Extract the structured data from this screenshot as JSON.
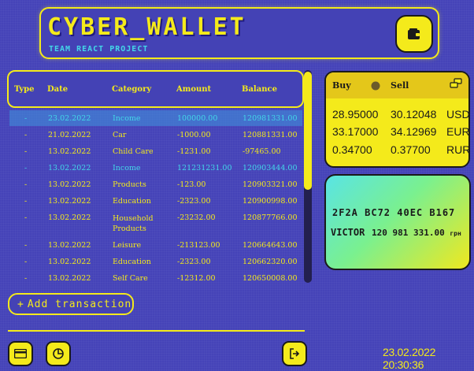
{
  "header": {
    "title": "CYBER_WALLET",
    "subtitle": "TEAM REACT PROJECT",
    "wallet_icon": "wallet-icon"
  },
  "table": {
    "headers": [
      "Type",
      "Date",
      "Category",
      "Amount",
      "Balance"
    ],
    "rows": [
      {
        "type": "-",
        "date": "23.02.2022",
        "category": "Income",
        "amount": "100000.00",
        "balance": "120981331.00",
        "kind": "income",
        "highlight": true
      },
      {
        "type": "-",
        "date": "21.02.2022",
        "category": "Car",
        "amount": "-1000.00",
        "balance": "120881331.00",
        "kind": "expense",
        "highlight": false
      },
      {
        "type": "-",
        "date": "13.02.2022",
        "category": "Child Care",
        "amount": "-1231.00",
        "balance": "-97465.00",
        "kind": "expense",
        "highlight": false
      },
      {
        "type": "-",
        "date": "13.02.2022",
        "category": "Income",
        "amount": "121231231.00",
        "balance": "120903444.00",
        "kind": "income",
        "highlight": false
      },
      {
        "type": "-",
        "date": "13.02.2022",
        "category": "Products",
        "amount": "-123.00",
        "balance": "120903321.00",
        "kind": "expense",
        "highlight": false
      },
      {
        "type": "-",
        "date": "13.02.2022",
        "category": "Education",
        "amount": "-2323.00",
        "balance": "120900998.00",
        "kind": "expense",
        "highlight": false
      },
      {
        "type": "-",
        "date": "13.02.2022",
        "category": "Household Products",
        "amount": "-23232.00",
        "balance": "120877766.00",
        "kind": "expense",
        "highlight": false
      },
      {
        "type": "-",
        "date": "13.02.2022",
        "category": "Leisure",
        "amount": "-213123.00",
        "balance": "120664643.00",
        "kind": "expense",
        "highlight": false
      },
      {
        "type": "-",
        "date": "13.02.2022",
        "category": "Education",
        "amount": "-2323.00",
        "balance": "120662320.00",
        "kind": "expense",
        "highlight": false
      },
      {
        "type": "-",
        "date": "13.02.2022",
        "category": "Self Care",
        "amount": "-12312.00",
        "balance": "120650008.00",
        "kind": "expense",
        "highlight": false
      }
    ]
  },
  "add_transaction": {
    "plus": "+",
    "label": "Add transaction"
  },
  "footer": {
    "datetime": "23.02.2022 20:30:36",
    "icons": [
      "card-icon",
      "pie-chart-icon",
      "logout-icon"
    ]
  },
  "currency": {
    "buy_label": "Buy",
    "sell_label": "Sell",
    "rates": [
      {
        "buy": "28.95000",
        "sell": "30.12048",
        "code": "USD"
      },
      {
        "buy": "33.17000",
        "sell": "34.12969",
        "code": "EUR"
      },
      {
        "buy": "0.34700",
        "sell": "0.37700",
        "code": "RUR"
      }
    ]
  },
  "card": {
    "number": "2F2A BC72 40EC B167",
    "holder": "VICTOR",
    "balance": "120 981 331.00",
    "currency": "грн"
  },
  "colors": {
    "background": "#4543b8",
    "accent": "#f4ea1b",
    "income": "#43d7e8"
  }
}
